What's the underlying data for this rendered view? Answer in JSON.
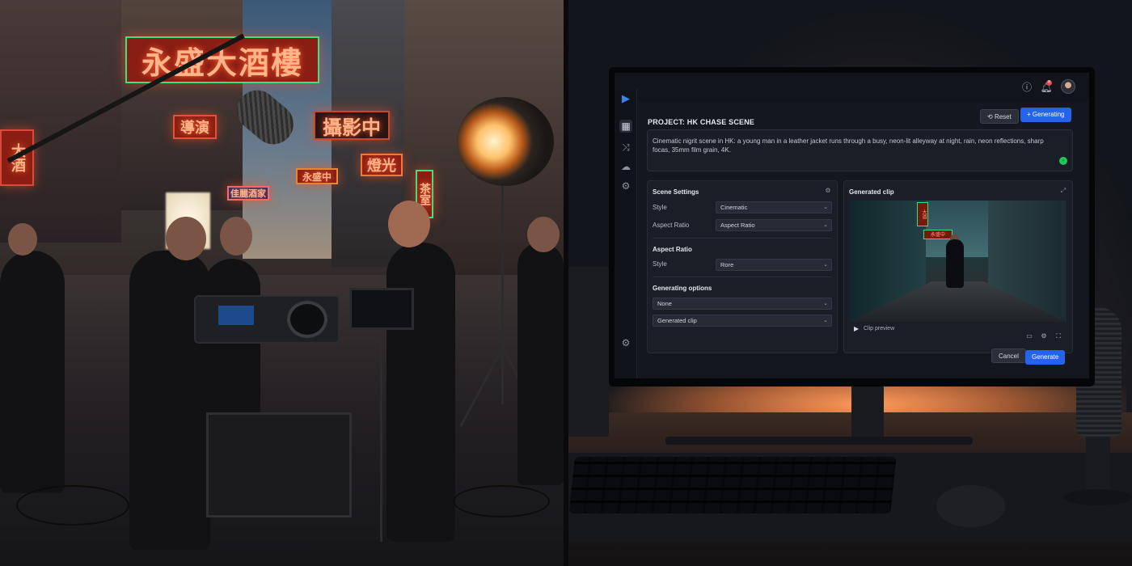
{
  "left_scene": {
    "neon_main": "永盛大酒樓",
    "neon_sign_2": "攝影中",
    "neon_sign_3": "導演",
    "neon_sign_4": "燈光",
    "neon_sign_5": "永盛中",
    "neon_sign_6": "佳麗酒家",
    "neon_vertical_1": "大酒",
    "neon_vertical_2": "茶室"
  },
  "app": {
    "rail_icons": [
      "logo-icon",
      "grid-icon",
      "shuffle-icon",
      "cloud-icon",
      "gear-icon",
      "settings-icon"
    ],
    "top_icons": [
      "info-icon",
      "bell-icon"
    ],
    "notification_count": "8",
    "project_title": "PROJECT: HK CHASE SCENE",
    "reset_label": "Reset",
    "primary_label": "Generating",
    "prompt_text": "Cinematic nigrit scene in HK: a young man in a leather jacket runs through a busy, neon-lit alleyway at night, rain, neon reflections, sharp focas, 35mm film grain, 4K.",
    "scene_settings": {
      "title": "Scene Settings",
      "style_label": "Style",
      "style_value": "Cinematic",
      "aspect_label": "Aspect Ratio",
      "aspect_value": "Aspect Ratio"
    },
    "aspect_section": {
      "title": "Aspect Ratio",
      "style_label": "Style",
      "style_value": "Rore"
    },
    "generating_options": {
      "title": "Generating options",
      "option_1": "None",
      "option_2": "Generated clip"
    },
    "clip_panel": {
      "title": "Generated clip",
      "caption": "Clip preview",
      "sign_a": "大酒",
      "sign_b": "永盛中"
    },
    "cancel_label": "Cancel",
    "generate_label": "Generate",
    "accent_color": "#2563eb"
  }
}
